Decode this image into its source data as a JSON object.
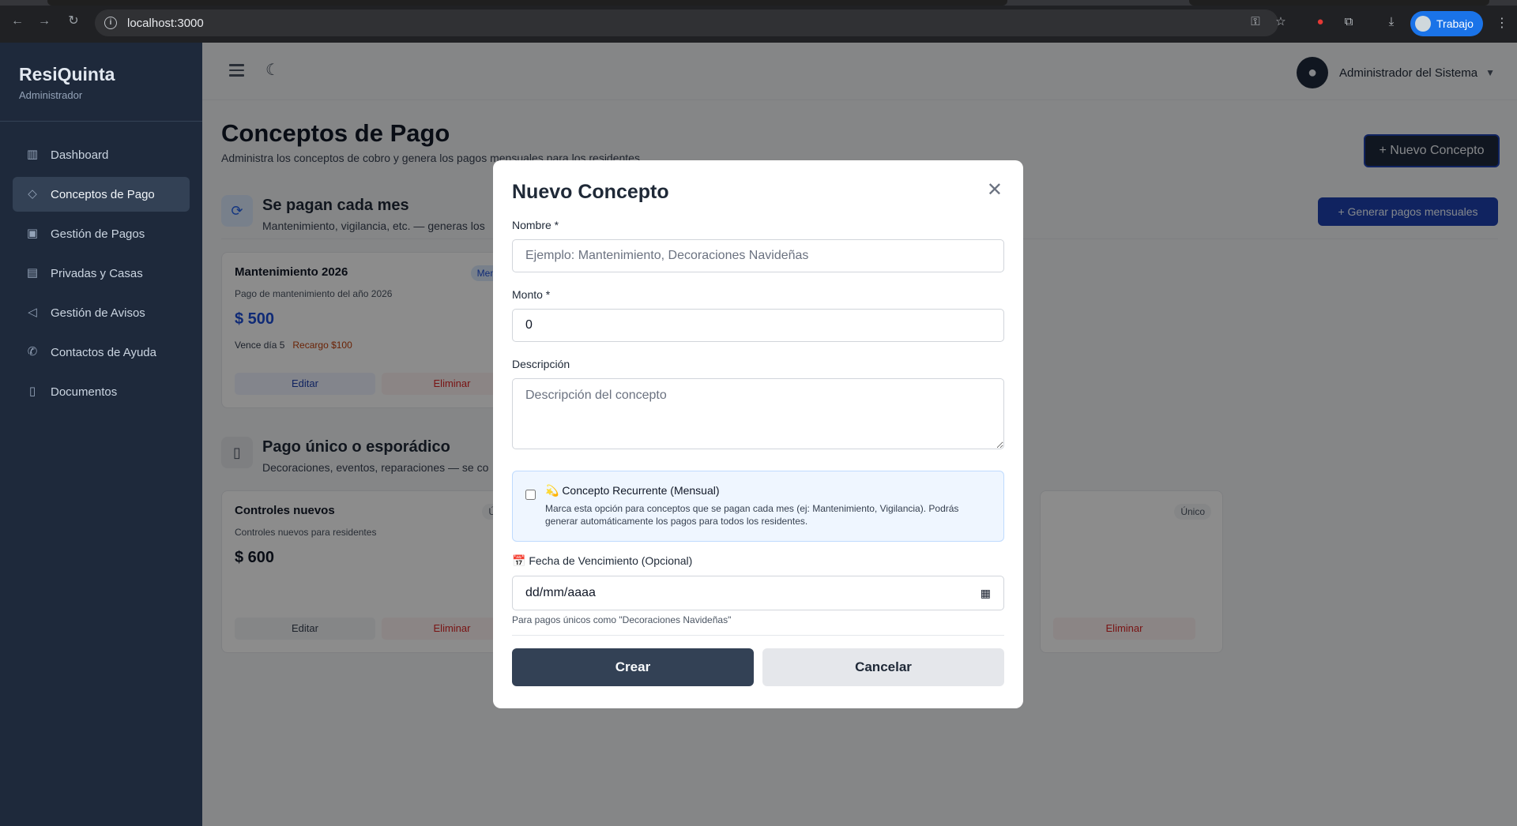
{
  "browser": {
    "url": "localhost:3000",
    "profile_label": "Trabajo"
  },
  "sidebar": {
    "brand": "ResiQuinta",
    "role": "Administrador",
    "items": [
      {
        "label": "Dashboard",
        "icon": "chart-icon"
      },
      {
        "label": "Conceptos de Pago",
        "icon": "tag-icon"
      },
      {
        "label": "Gestión de Pagos",
        "icon": "money-icon"
      },
      {
        "label": "Privadas y Casas",
        "icon": "building-icon"
      },
      {
        "label": "Gestión de Avisos",
        "icon": "megaphone-icon"
      },
      {
        "label": "Contactos de Ayuda",
        "icon": "phone-icon"
      },
      {
        "label": "Documentos",
        "icon": "document-icon"
      }
    ]
  },
  "header": {
    "user_name": "Administrador del Sistema"
  },
  "page": {
    "title": "Conceptos de Pago",
    "subtitle": "Administra los conceptos de cobro y genera los pagos mensuales para los residentes",
    "new_button": "+ Nuevo Concepto",
    "generate_button": "+   Generar pagos mensuales",
    "recurring_section": {
      "title": "Se pagan cada mes",
      "desc": "Mantenimiento, vigilancia, etc. — generas los"
    },
    "single_section": {
      "title": "Pago único o esporádico",
      "desc": "Decoraciones, eventos, reparaciones — se co"
    },
    "cards": [
      {
        "title": "Mantenimiento 2026",
        "desc": "Pago de mantenimiento del año 2026",
        "amount": "$ 500",
        "due": "Vence día 5",
        "surcharge": "Recargo $100",
        "badge": "Men",
        "edit": "Editar",
        "delete": "Eliminar"
      },
      {
        "title": "Controles nuevos",
        "desc": "Controles nuevos para residentes",
        "amount": "$ 600",
        "badge": "Ú",
        "edit": "Editar",
        "delete": "Eliminar"
      },
      {
        "badge": "Único",
        "delete": "Eliminar"
      }
    ]
  },
  "modal": {
    "title": "Nuevo Concepto",
    "name_label": "Nombre *",
    "name_placeholder": "Ejemplo: Mantenimiento, Decoraciones Navideñas",
    "amount_label": "Monto *",
    "amount_value": "0",
    "desc_label": "Descripción",
    "desc_placeholder": "Descripción del concepto",
    "recurring_title": "💫 Concepto Recurrente (Mensual)",
    "recurring_desc": "Marca esta opción para conceptos que se pagan cada mes (ej: Mantenimiento, Vigilancia). Podrás generar automáticamente los pagos para todos los residentes.",
    "recurring_checked": false,
    "date_label": "📅 Fecha de Vencimiento (Opcional)",
    "date_value": "dd/mm/aaaa",
    "date_hint": "Para pagos únicos como \"Decoraciones Navideñas\"",
    "create_button": "Crear",
    "cancel_button": "Cancelar"
  }
}
